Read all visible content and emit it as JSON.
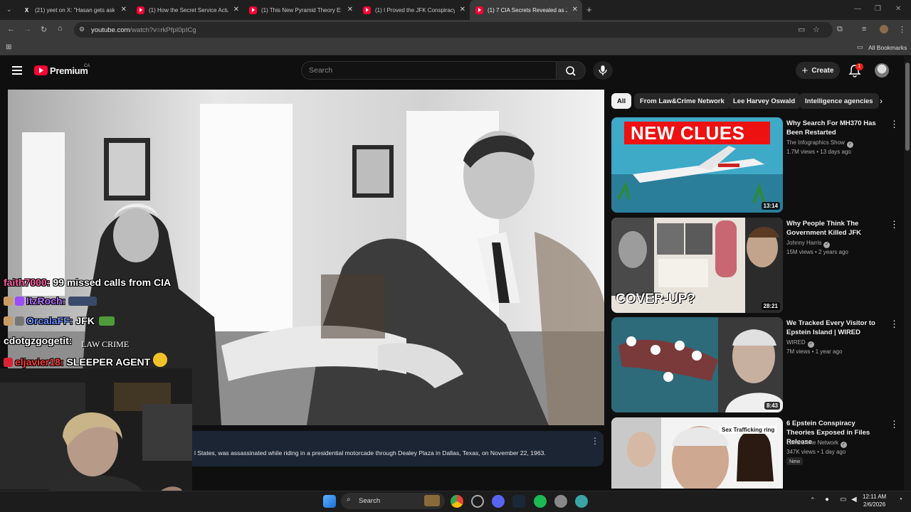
{
  "browser": {
    "tabs": [
      {
        "title": "(21) yeet on X: \"Hasan gets ask",
        "favicon": "x-logo-icon",
        "active": false
      },
      {
        "title": "(1) How the Secret Service Actu",
        "favicon": "youtube-icon",
        "active": false
      },
      {
        "title": "(1) This New Pyramid Theory Ex",
        "favicon": "youtube-icon",
        "active": false
      },
      {
        "title": "(1) I Proved the JFK Conspiracy",
        "favicon": "youtube-icon",
        "active": false
      },
      {
        "title": "(1) 7 CIA Secrets Revealed as JF",
        "favicon": "youtube-icon",
        "active": true
      }
    ],
    "url_host": "youtube.com",
    "url_path": "/watch?v=rkPfpI0pICg",
    "bookmarks_label": "All Bookmarks"
  },
  "youtube": {
    "brand": "Premium",
    "region": "CA",
    "search_placeholder": "Search",
    "create_label": "Create",
    "notification_count": "1",
    "caption_text": "l States, was assassinated while riding in a presidential motorcade through Dealey Plaza in Dallas, Texas, on November 22, 1963.",
    "chips": [
      "All",
      "From Law&Crime Network",
      "Lee Harvey Oswald",
      "Intelligence agencies"
    ],
    "recommendations": [
      {
        "title": "Why Search For MH370 Has Been Restarted",
        "channel": "The Infographics Show",
        "views": "1.7M views",
        "age": "13 days ago",
        "duration": "13:14",
        "thumb_text": "NEW CLUES",
        "badge": ""
      },
      {
        "title": "Why People Think The Government Killed JFK",
        "channel": "Johnny Harris",
        "views": "15M views",
        "age": "2 years ago",
        "duration": "28:21",
        "thumb_text": "COVER-UP?",
        "badge": ""
      },
      {
        "title": "We Tracked Every Visitor to Epstein Island | WIRED",
        "channel": "WIRED",
        "views": "7M views",
        "age": "1 year ago",
        "duration": "8:43",
        "thumb_text": "",
        "badge": ""
      },
      {
        "title": "6 Epstein Conspiracy Theories Exposed in Files Release",
        "channel": "Law&Crime Network",
        "views": "347K views",
        "age": "1 day ago",
        "duration": "",
        "thumb_text": "Sex Trafficking ring",
        "badge": "New"
      }
    ]
  },
  "chat_overlay": [
    {
      "user": "faith7000:",
      "message": "99 missed calls from CIA",
      "color": "#ff5fa2"
    },
    {
      "user": "ItzRoch:",
      "message": "",
      "color": "#b06cff"
    },
    {
      "user": "OrcalaFF:",
      "message": "JFK",
      "color": "#6b8cff"
    },
    {
      "user": "cdotgzgogetit:",
      "message": "",
      "color": "#ffffff"
    },
    {
      "user": "eljavier18:",
      "message": "SLEEPER AGENT",
      "color": "#ff3a3a"
    }
  ],
  "stream_watermark": "LAW CRIME",
  "taskbar": {
    "search_label": "Search",
    "time": "12:11 AM",
    "date": "2/6/2026"
  }
}
